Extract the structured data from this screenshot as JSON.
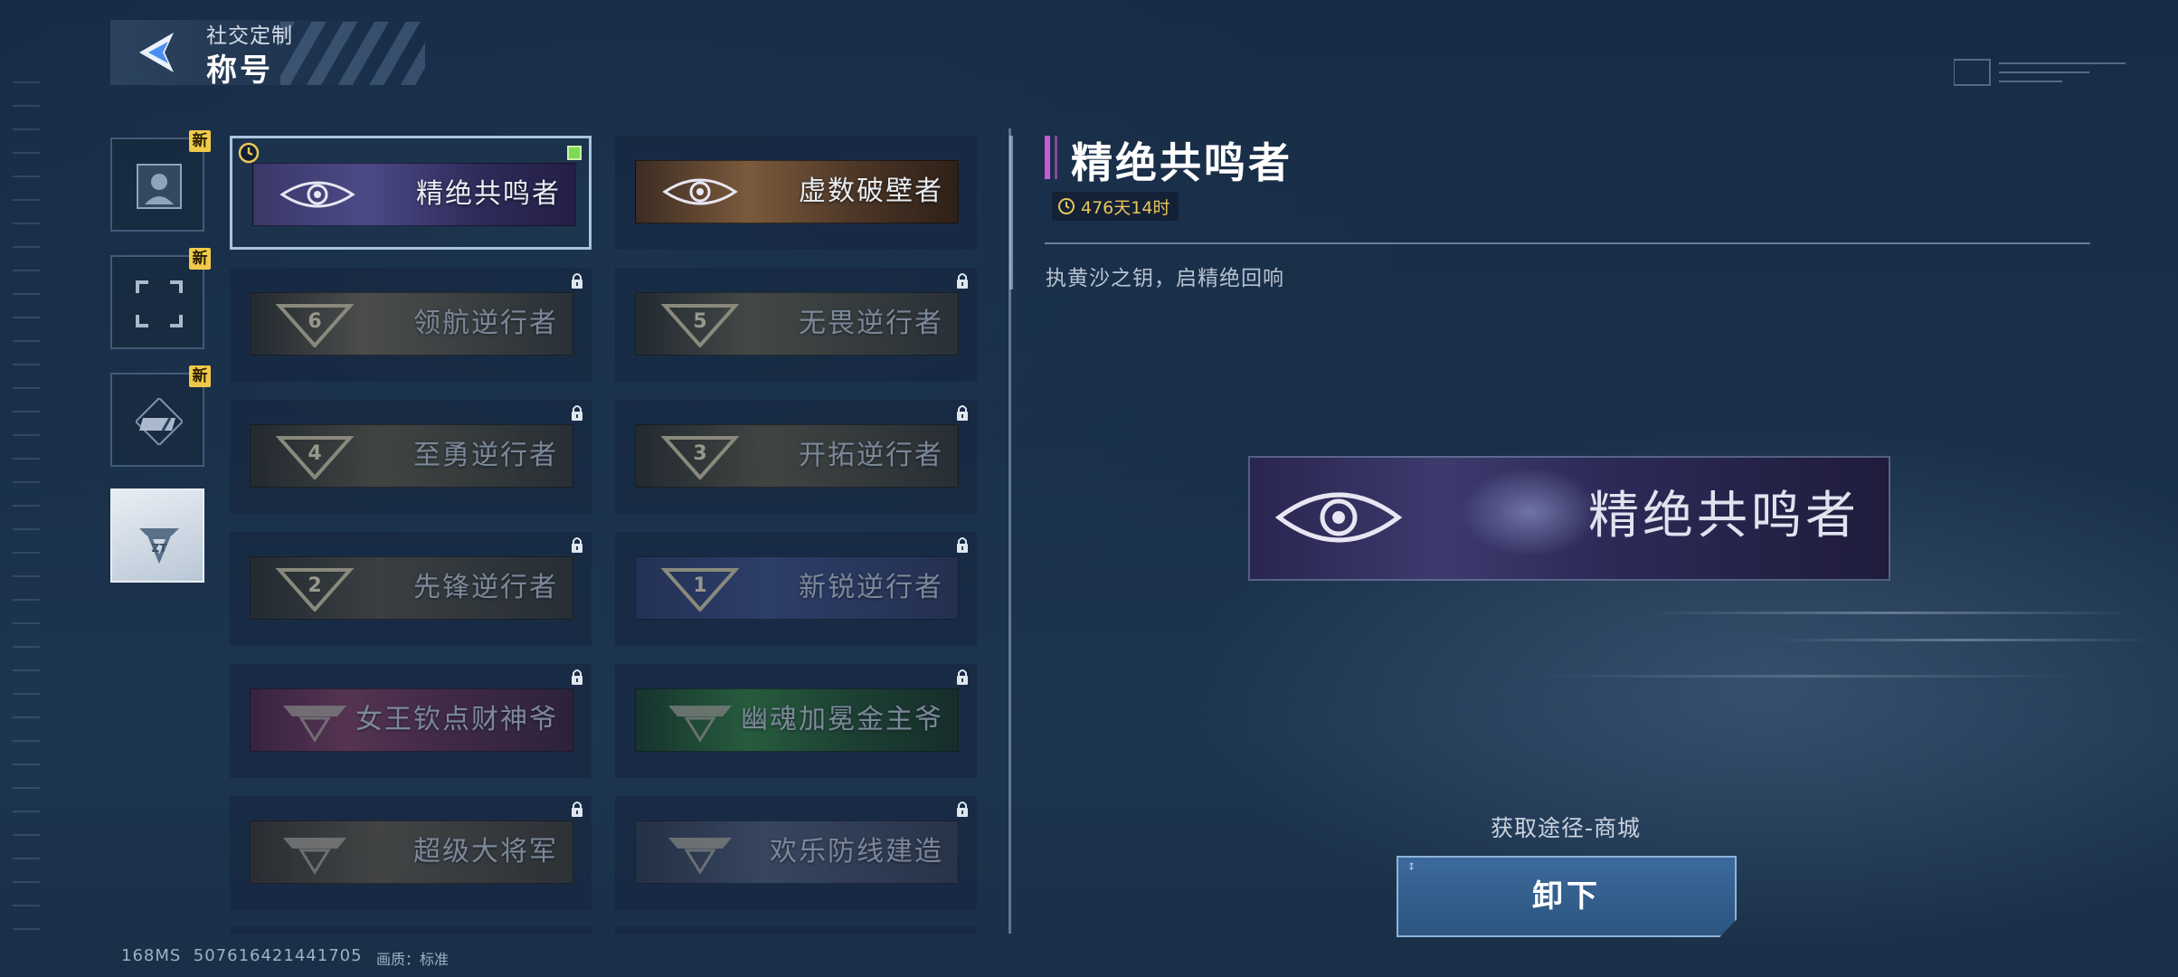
{
  "header": {
    "subtitle": "社交定制",
    "title": "称号"
  },
  "categories": [
    {
      "name": "avatar",
      "badge": "新",
      "selected": false
    },
    {
      "name": "frame",
      "badge": "新",
      "selected": false
    },
    {
      "name": "nameplate",
      "badge": "新",
      "selected": false
    },
    {
      "name": "title",
      "badge": "",
      "selected": true
    }
  ],
  "titles": [
    {
      "name": "精绝共鸣者",
      "locked": false,
      "selected": true,
      "equipped": true,
      "timed": true
    },
    {
      "name": "虚数破壁者",
      "locked": false,
      "selected": false
    },
    {
      "name": "领航逆行者",
      "locked": true,
      "rank": "6"
    },
    {
      "name": "无畏逆行者",
      "locked": true,
      "rank": "5"
    },
    {
      "name": "至勇逆行者",
      "locked": true,
      "rank": "4"
    },
    {
      "name": "开拓逆行者",
      "locked": true,
      "rank": "3"
    },
    {
      "name": "先锋逆行者",
      "locked": true,
      "rank": "2"
    },
    {
      "name": "新锐逆行者",
      "locked": true,
      "rank": "1"
    },
    {
      "name": "女王钦点财神爷",
      "locked": true
    },
    {
      "name": "幽魂加冕金主爷",
      "locked": true
    },
    {
      "name": "超级大将军",
      "locked": true
    },
    {
      "name": "欢乐防线建造",
      "locked": true
    }
  ],
  "detail": {
    "title": "精绝共鸣者",
    "timer": "476天14时",
    "description": "执黄沙之钥，启精绝回响",
    "preview_name": "精绝共鸣者",
    "source": "获取途径-商城",
    "action_label": "卸下"
  },
  "footer": {
    "ping": "168MS",
    "uid": "507616421441705",
    "quality": "画质：标准"
  },
  "colors": {
    "accent_purple": "#c85ad8",
    "timer_gold": "#e9c65a",
    "badge_yellow": "#f1c94a",
    "equipped_green": "#7ed957",
    "button_blue": "#2c5580"
  }
}
